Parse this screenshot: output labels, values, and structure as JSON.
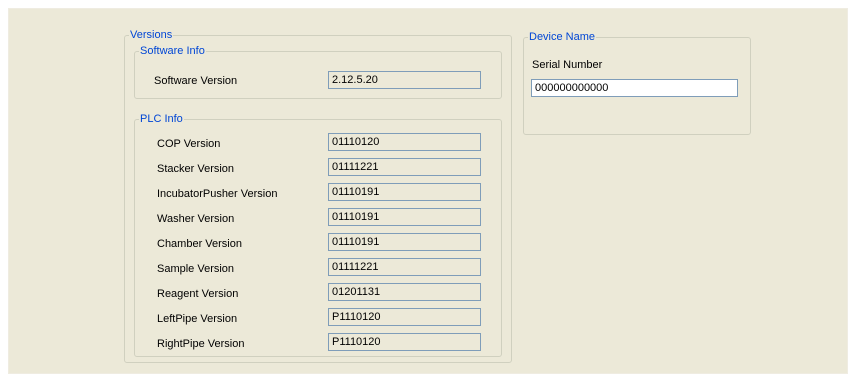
{
  "versions": {
    "legend": "Versions",
    "software_info": {
      "legend": "Software Info",
      "software_version_label": "Software Version",
      "software_version_value": "2.12.5.20"
    },
    "plc_info": {
      "legend": "PLC Info",
      "rows": [
        {
          "label": "COP Version",
          "value": "01110120"
        },
        {
          "label": "Stacker Version",
          "value": "01111221"
        },
        {
          "label": "IncubatorPusher Version",
          "value": "01110191"
        },
        {
          "label": "Washer Version",
          "value": "01110191"
        },
        {
          "label": "Chamber Version",
          "value": "01110191"
        },
        {
          "label": "Sample Version",
          "value": "01111221"
        },
        {
          "label": "Reagent Version",
          "value": "01201131"
        },
        {
          "label": "LeftPipe Version",
          "value": "P1110120"
        },
        {
          "label": "RightPipe Version",
          "value": "P1110120"
        }
      ]
    }
  },
  "device_name": {
    "legend": "Device Name",
    "serial_number_label": "Serial Number",
    "serial_number_value": "000000000000"
  },
  "colors": {
    "panel_background": "#ece9d8",
    "legend_text": "#0046d5",
    "field_border": "#7f9db9"
  }
}
